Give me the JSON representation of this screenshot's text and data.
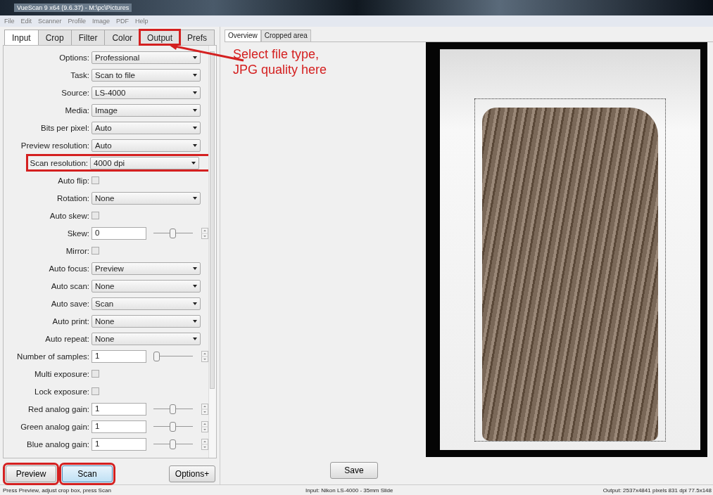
{
  "window": {
    "title": "VueScan 9 x64 (9.6.37) - M:\\pc\\Pictures"
  },
  "menu": [
    "File",
    "Edit",
    "Scanner",
    "Profile",
    "Image",
    "PDF",
    "Help"
  ],
  "tabs": [
    {
      "label": "Input",
      "selected": true,
      "highlighted": false
    },
    {
      "label": "Crop",
      "selected": false,
      "highlighted": false
    },
    {
      "label": "Filter",
      "selected": false,
      "highlighted": false
    },
    {
      "label": "Color",
      "selected": false,
      "highlighted": false
    },
    {
      "label": "Output",
      "selected": false,
      "highlighted": true
    },
    {
      "label": "Prefs",
      "selected": false,
      "highlighted": false
    }
  ],
  "settings": [
    {
      "kind": "select",
      "label": "Options:",
      "value": "Professional",
      "highlighted": false
    },
    {
      "kind": "select",
      "label": "Task:",
      "value": "Scan to file",
      "highlighted": false
    },
    {
      "kind": "select",
      "label": "Source:",
      "value": "LS-4000",
      "highlighted": false
    },
    {
      "kind": "select",
      "label": "Media:",
      "value": "Image",
      "highlighted": false
    },
    {
      "kind": "select",
      "label": "Bits per pixel:",
      "value": "Auto",
      "highlighted": false
    },
    {
      "kind": "select",
      "label": "Preview resolution:",
      "value": "Auto",
      "highlighted": false
    },
    {
      "kind": "select",
      "label": "Scan resolution:",
      "value": "4000 dpi",
      "highlighted": true
    },
    {
      "kind": "checkbox",
      "label": "Auto flip:",
      "checked": false
    },
    {
      "kind": "select",
      "label": "Rotation:",
      "value": "None",
      "highlighted": false
    },
    {
      "kind": "checkbox",
      "label": "Auto skew:",
      "checked": false
    },
    {
      "kind": "spin",
      "label": "Skew:",
      "value": "0",
      "level": 0.5
    },
    {
      "kind": "checkbox",
      "label": "Mirror:",
      "checked": false
    },
    {
      "kind": "select",
      "label": "Auto focus:",
      "value": "Preview",
      "highlighted": false
    },
    {
      "kind": "select",
      "label": "Auto scan:",
      "value": "None",
      "highlighted": false
    },
    {
      "kind": "select",
      "label": "Auto save:",
      "value": "Scan",
      "highlighted": false
    },
    {
      "kind": "select",
      "label": "Auto print:",
      "value": "None",
      "highlighted": false
    },
    {
      "kind": "select",
      "label": "Auto repeat:",
      "value": "None",
      "highlighted": false
    },
    {
      "kind": "spin",
      "label": "Number of samples:",
      "value": "1",
      "level": 0
    },
    {
      "kind": "checkbox",
      "label": "Multi exposure:",
      "checked": false
    },
    {
      "kind": "checkbox",
      "label": "Lock exposure:",
      "checked": false
    },
    {
      "kind": "spin",
      "label": "Red analog gain:",
      "value": "1",
      "level": 0.5
    },
    {
      "kind": "spin",
      "label": "Green analog gain:",
      "value": "1",
      "level": 0.5
    },
    {
      "kind": "spin",
      "label": "Blue analog gain:",
      "value": "1",
      "level": 0.5
    }
  ],
  "buttons": [
    {
      "label": "Preview",
      "highlighted": true
    },
    {
      "label": "Scan",
      "highlighted": true
    }
  ],
  "options_button": "Options+",
  "view_tabs": [
    {
      "label": "Overview",
      "selected": true
    },
    {
      "label": "Cropped area",
      "selected": false
    }
  ],
  "annotation": "Select file type,\nJPG quality here",
  "save_button": "Save",
  "status_bar": [
    "Press Preview, adjust crop box, press Scan",
    "Input: Nikon LS-4000 - 35mm Slide",
    "Output: 2537x4841 pixels 831 dpi 77.5x148"
  ]
}
